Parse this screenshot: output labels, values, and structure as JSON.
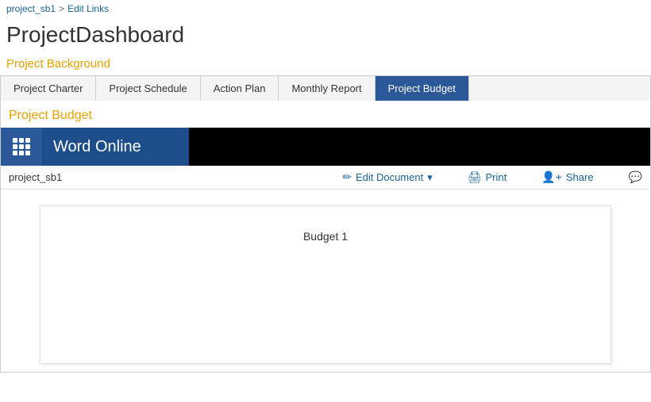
{
  "breadcrumb": {
    "part1": "project_sb1",
    "separator": ">",
    "part2": "Edit Links"
  },
  "pageTitle": "ProjectDashboard",
  "sectionHeading": "Project Background",
  "tabs": [
    {
      "label": "Project Charter",
      "active": false
    },
    {
      "label": "Project Schedule",
      "active": false
    },
    {
      "label": "Action Plan",
      "active": false
    },
    {
      "label": "Monthly Report",
      "active": false
    },
    {
      "label": "Project Budget",
      "active": true
    }
  ],
  "tabContentTitle": "Project Budget",
  "wordOnline": {
    "title": "Word Online",
    "appBarBg": "#000000",
    "brandBg": "#1e4d8c",
    "waffleBg": "#2a5898"
  },
  "toolbar": {
    "filename": "project_sb1",
    "editDocumentLabel": "Edit Document",
    "printLabel": "Print",
    "shareLabel": "Share",
    "commentIcon": "C"
  },
  "docContent": {
    "text": "Budget 1"
  },
  "icons": {
    "pencil": "✏",
    "printer": "🖨",
    "share": "👤",
    "comment": "💬"
  }
}
